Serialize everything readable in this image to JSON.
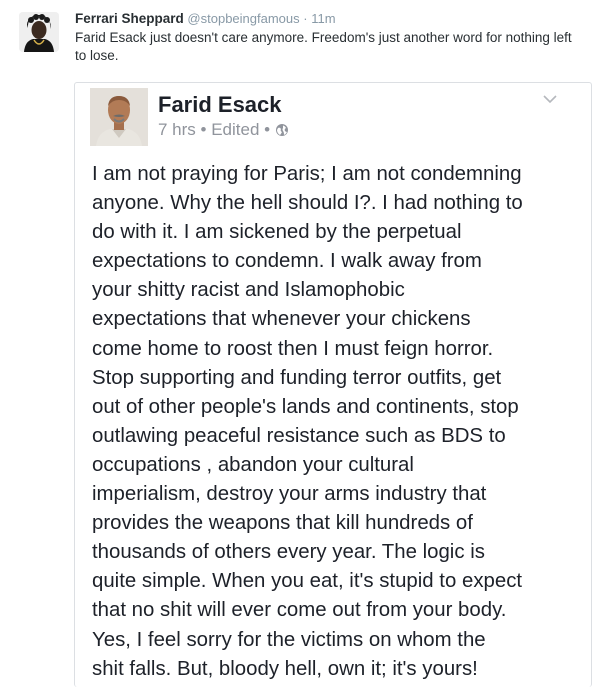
{
  "tweet": {
    "author_name": "Ferrari Sheppard",
    "author_handle": "@stopbeingfamous",
    "separator": "·",
    "time_ago": "11m",
    "text": "Farid Esack just doesn't care anymore.  Freedom's just another word for nothing left to lose."
  },
  "facebook_post": {
    "author_name": "Farid Esack",
    "time_ago": "7 hrs",
    "edited_label": "Edited",
    "separator": "•",
    "privacy_icon": "globe-icon",
    "menu_icon": "chevron-down-icon",
    "text": "I am not praying for Paris; I am not condemning\nanyone. Why the hell should I?. I had nothing to\ndo with it.  I am sickened by the perpetual\nexpectations to condemn. I walk away from\nyour shitty racist and Islamophobic\nexpectations that whenever your chickens\ncome home to roost then I must feign horror.\nStop supporting and funding terror outfits, get\nout of other people's lands and continents, stop\noutlawing peaceful resistance such as BDS to\noccupations , abandon your cultural\nimperialism, destroy your arms industry that\nprovides the weapons that kill hundreds of\nthousands of others every year. The logic is\nquite simple. When you eat, it's stupid to expect\nthat no shit will ever come out from your body.\nYes, I feel sorry for the victims on whom the\nshit falls. But, bloody hell, own it; it's yours!"
  },
  "colors": {
    "tweet_text": "#292f33",
    "meta_gray": "#8899a6",
    "fb_text": "#1d2129",
    "fb_meta": "#90949c",
    "border": "#dcdfe3"
  }
}
